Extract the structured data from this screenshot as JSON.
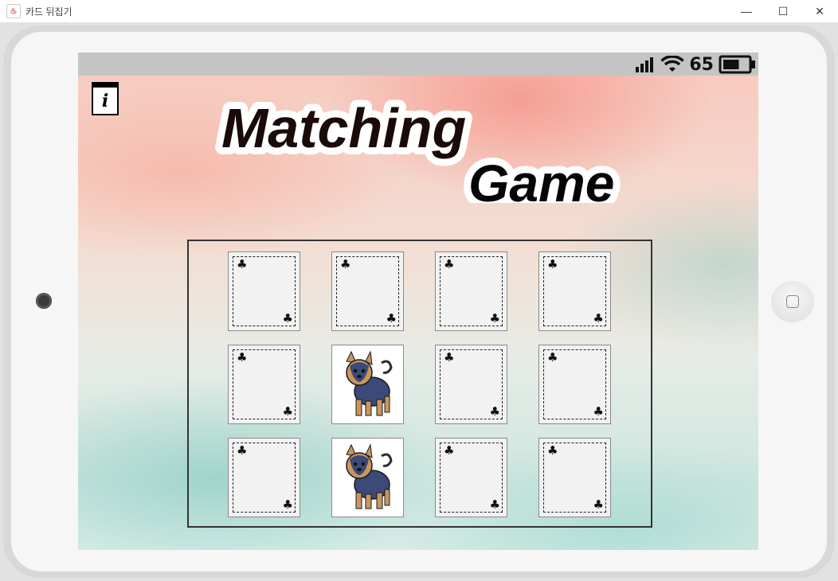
{
  "window": {
    "title": "카드 뒤집기",
    "app_icon_glyph": "java-cup-icon",
    "controls": {
      "minimize": "—",
      "maximize": "☐",
      "close": "✕"
    }
  },
  "status_bar": {
    "battery_value": "65",
    "icons": [
      "signal-bars-icon",
      "wifi-icon",
      "battery-icon"
    ],
    "battery_level_fraction": 0.65
  },
  "info_button": {
    "label": "i",
    "icon": "info-book-icon"
  },
  "logo": {
    "word1": "Matching",
    "word2": "Game"
  },
  "board": {
    "rows": 3,
    "columns": 4,
    "back_suit_glyph": "♣",
    "cards": [
      {
        "row": 1,
        "col": 1,
        "state": "face-down"
      },
      {
        "row": 1,
        "col": 2,
        "state": "face-down"
      },
      {
        "row": 1,
        "col": 3,
        "state": "face-down"
      },
      {
        "row": 1,
        "col": 4,
        "state": "face-down"
      },
      {
        "row": 2,
        "col": 1,
        "state": "face-down"
      },
      {
        "row": 2,
        "col": 2,
        "state": "face-up",
        "image": "yorkshire-terrier-dog"
      },
      {
        "row": 2,
        "col": 3,
        "state": "face-down"
      },
      {
        "row": 2,
        "col": 4,
        "state": "face-down"
      },
      {
        "row": 3,
        "col": 1,
        "state": "face-down"
      },
      {
        "row": 3,
        "col": 2,
        "state": "face-up",
        "image": "yorkshire-terrier-dog"
      },
      {
        "row": 3,
        "col": 3,
        "state": "face-down"
      },
      {
        "row": 3,
        "col": 4,
        "state": "face-down"
      }
    ]
  },
  "colors": {
    "status_bar": "#c4c4c4",
    "board_border": "#333333",
    "card_back": "#f2f2f2",
    "logo_text": "#1a0a0a",
    "logo_outline": "#ffffff"
  }
}
